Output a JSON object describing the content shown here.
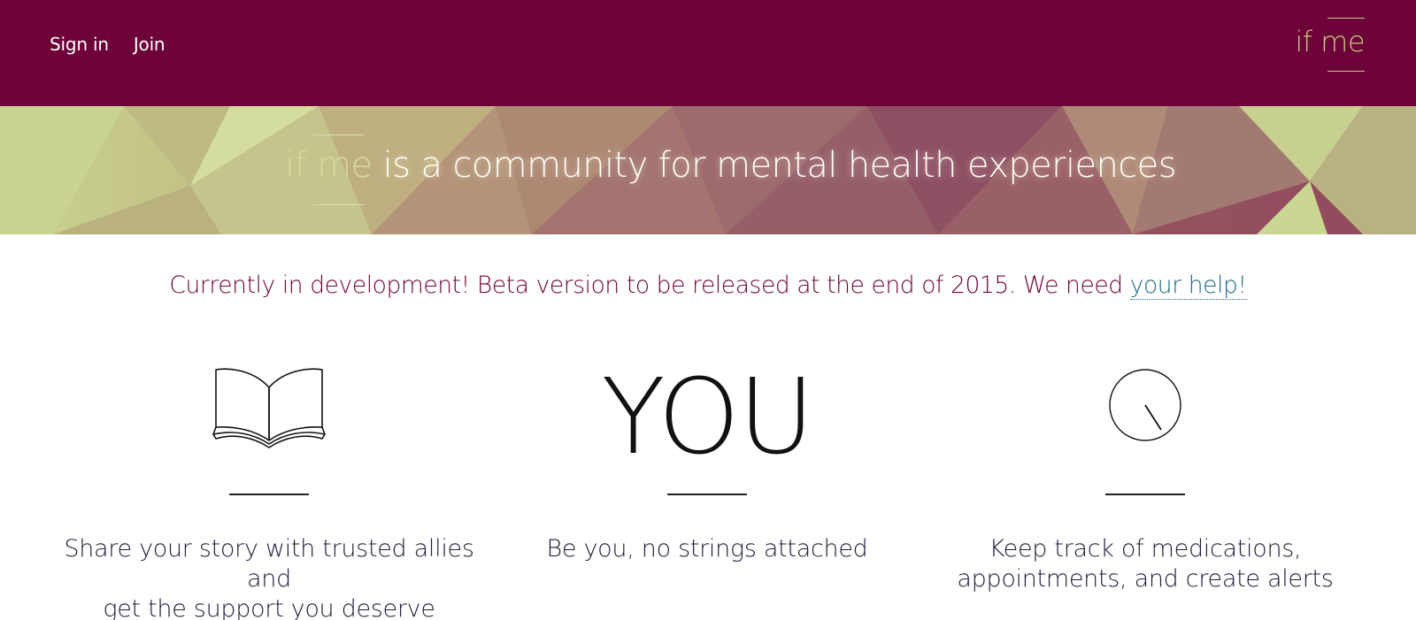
{
  "nav": {
    "sign_in": "Sign in",
    "join": "Join"
  },
  "brand": {
    "name": "if me"
  },
  "hero": {
    "brand_word": "if me",
    "tagline": " is a community for mental health experiences"
  },
  "notice": {
    "text": "Currently in development! Beta version to be released at the end of 2015. We need ",
    "link": "your help!"
  },
  "features": [
    {
      "icon": "book-icon",
      "caption_line1": "Share your story with trusted allies and",
      "caption_line2": "get the support you deserve"
    },
    {
      "icon": "you-text",
      "you_label": "YOU",
      "caption_line1": "Be you, no strings attached",
      "caption_line2": ""
    },
    {
      "icon": "clock-icon",
      "caption_line1": "Keep track of medications,",
      "caption_line2": "appointments, and create alerts"
    }
  ],
  "colors": {
    "header_bg": "#6e0339",
    "brand_accent": "#c2c97f",
    "notice_text": "#6e0339",
    "link": "#1f6a86"
  }
}
